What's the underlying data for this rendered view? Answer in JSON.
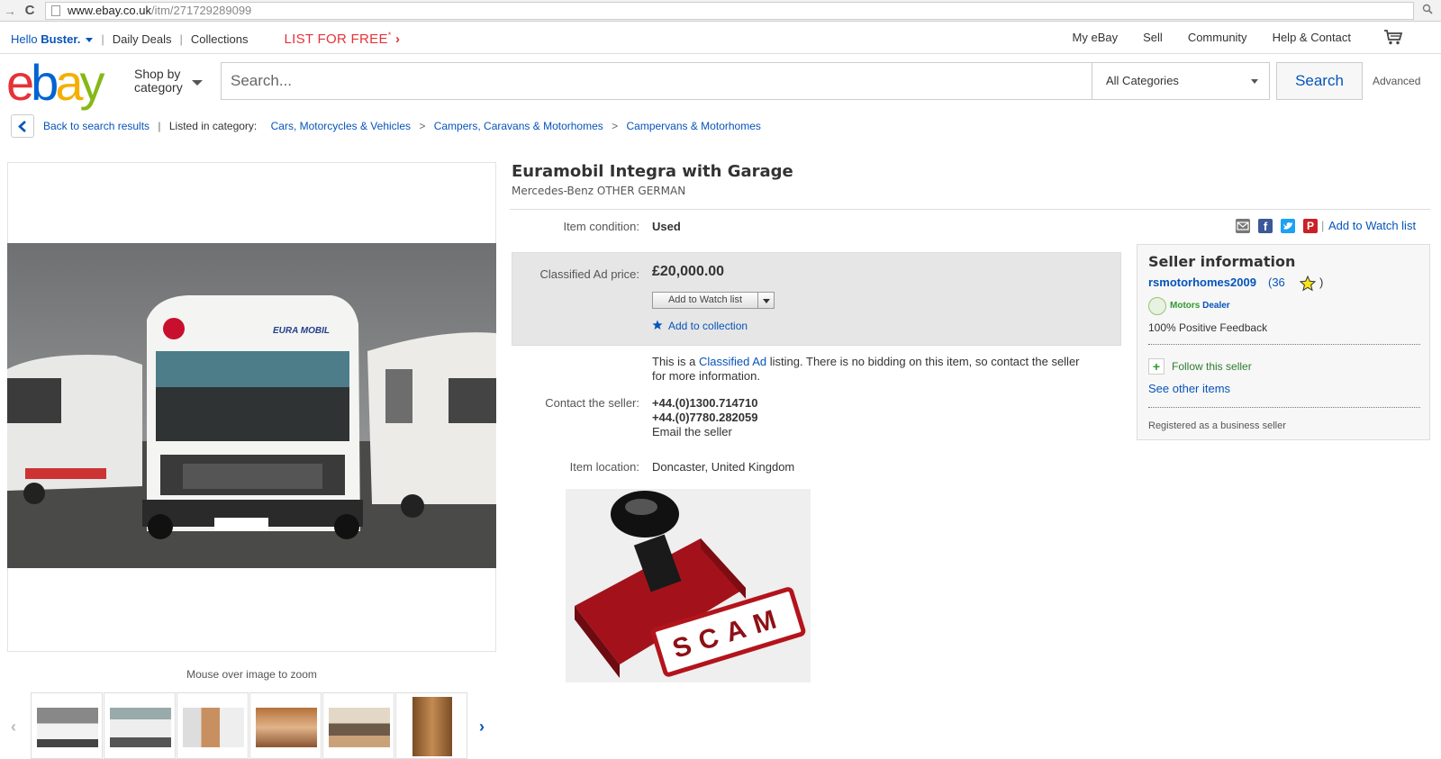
{
  "browser": {
    "url_host": "www.ebay.co.uk",
    "url_path": "/itm/271729289099"
  },
  "header": {
    "hello_prefix": "Hello",
    "user_name": "Buster.",
    "daily_deals": "Daily Deals",
    "collections": "Collections",
    "list_for_free": "LIST FOR FREE",
    "list_sup": "*",
    "right_links": [
      "My eBay",
      "Sell",
      "Community",
      "Help & Contact"
    ]
  },
  "logo": {
    "e": "e",
    "b": "b",
    "a": "a",
    "y": "y"
  },
  "search": {
    "shop_by": "Shop by",
    "category": "category",
    "placeholder": "Search...",
    "category_selected": "All Categories",
    "button": "Search",
    "advanced": "Advanced"
  },
  "breadcrumb": {
    "back": "Back to search results",
    "listed_in": "Listed in category:",
    "path": [
      "Cars, Motorcycles & Vehicles",
      "Campers, Caravans & Motorhomes",
      "Campervans & Motorhomes"
    ]
  },
  "gallery": {
    "zoom_hint": "Mouse over image to zoom"
  },
  "item": {
    "title": "Euramobil Integra with Garage",
    "subtitle": "Mercedes-Benz OTHER GERMAN",
    "condition_label": "Item condition:",
    "condition_value": "Used",
    "add_to_watch_list_top": "Add to Watch list",
    "price_label": "Classified Ad price:",
    "price": "£20,000.00",
    "watch_btn": "Add to Watch list",
    "add_to_collection": "Add to collection",
    "classified_text_1": "This is a ",
    "classified_link": "Classified Ad",
    "classified_text_2": " listing. There is no bidding on this item, so contact the seller for more information.",
    "contact_label": "Contact the seller:",
    "phone_1": "+44.(0)1300.714710",
    "phone_2": "+44.(0)7780.282059",
    "email_seller": "Email the seller",
    "location_label": "Item location:",
    "location_value": "Doncaster, United Kingdom",
    "scam_text": "SCAM"
  },
  "seller": {
    "heading": "Seller information",
    "name": "rsmotorhomes2009",
    "feedback_open": "(36",
    "feedback_close": ")",
    "motors": "Motors",
    "dealer": "Dealer",
    "positive": "100% Positive Feedback",
    "follow": "Follow this seller",
    "other_items": "See other items",
    "registered": "Registered as a business seller"
  },
  "colors": {
    "link": "#0654ba",
    "ebay_red": "#e53238",
    "ebay_blue": "#0064d2",
    "ebay_yellow": "#f5af02",
    "ebay_green": "#86b817"
  }
}
